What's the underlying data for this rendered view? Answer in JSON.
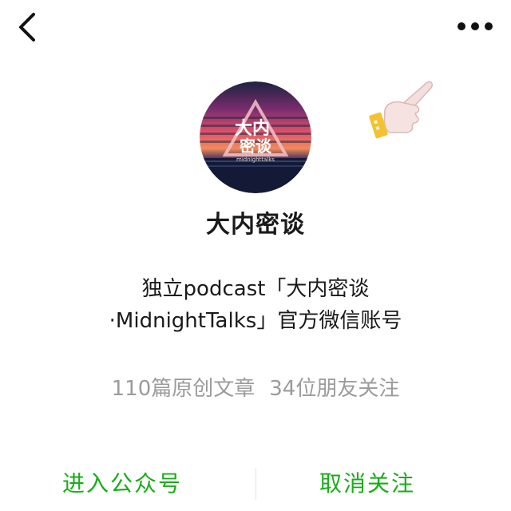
{
  "header": {
    "back_icon": "chevron-left-icon",
    "more_icon": "more-dots-icon"
  },
  "hint": {
    "icon": "pointing-hand-icon"
  },
  "account": {
    "avatar_text_main": "大内",
    "avatar_text_sub": "密谈",
    "avatar_caption": "midnighttalks",
    "name": "大内密谈",
    "description_line1": "独立podcast「大内密谈",
    "description_line2": "·MidnightTalks」官方微信账号",
    "articles": "110篇原创文章",
    "friends": "34位朋友关注"
  },
  "actions": {
    "enter_label": "进入公众号",
    "unfollow_label": "取消关注",
    "accent_color": "#1aad19"
  }
}
